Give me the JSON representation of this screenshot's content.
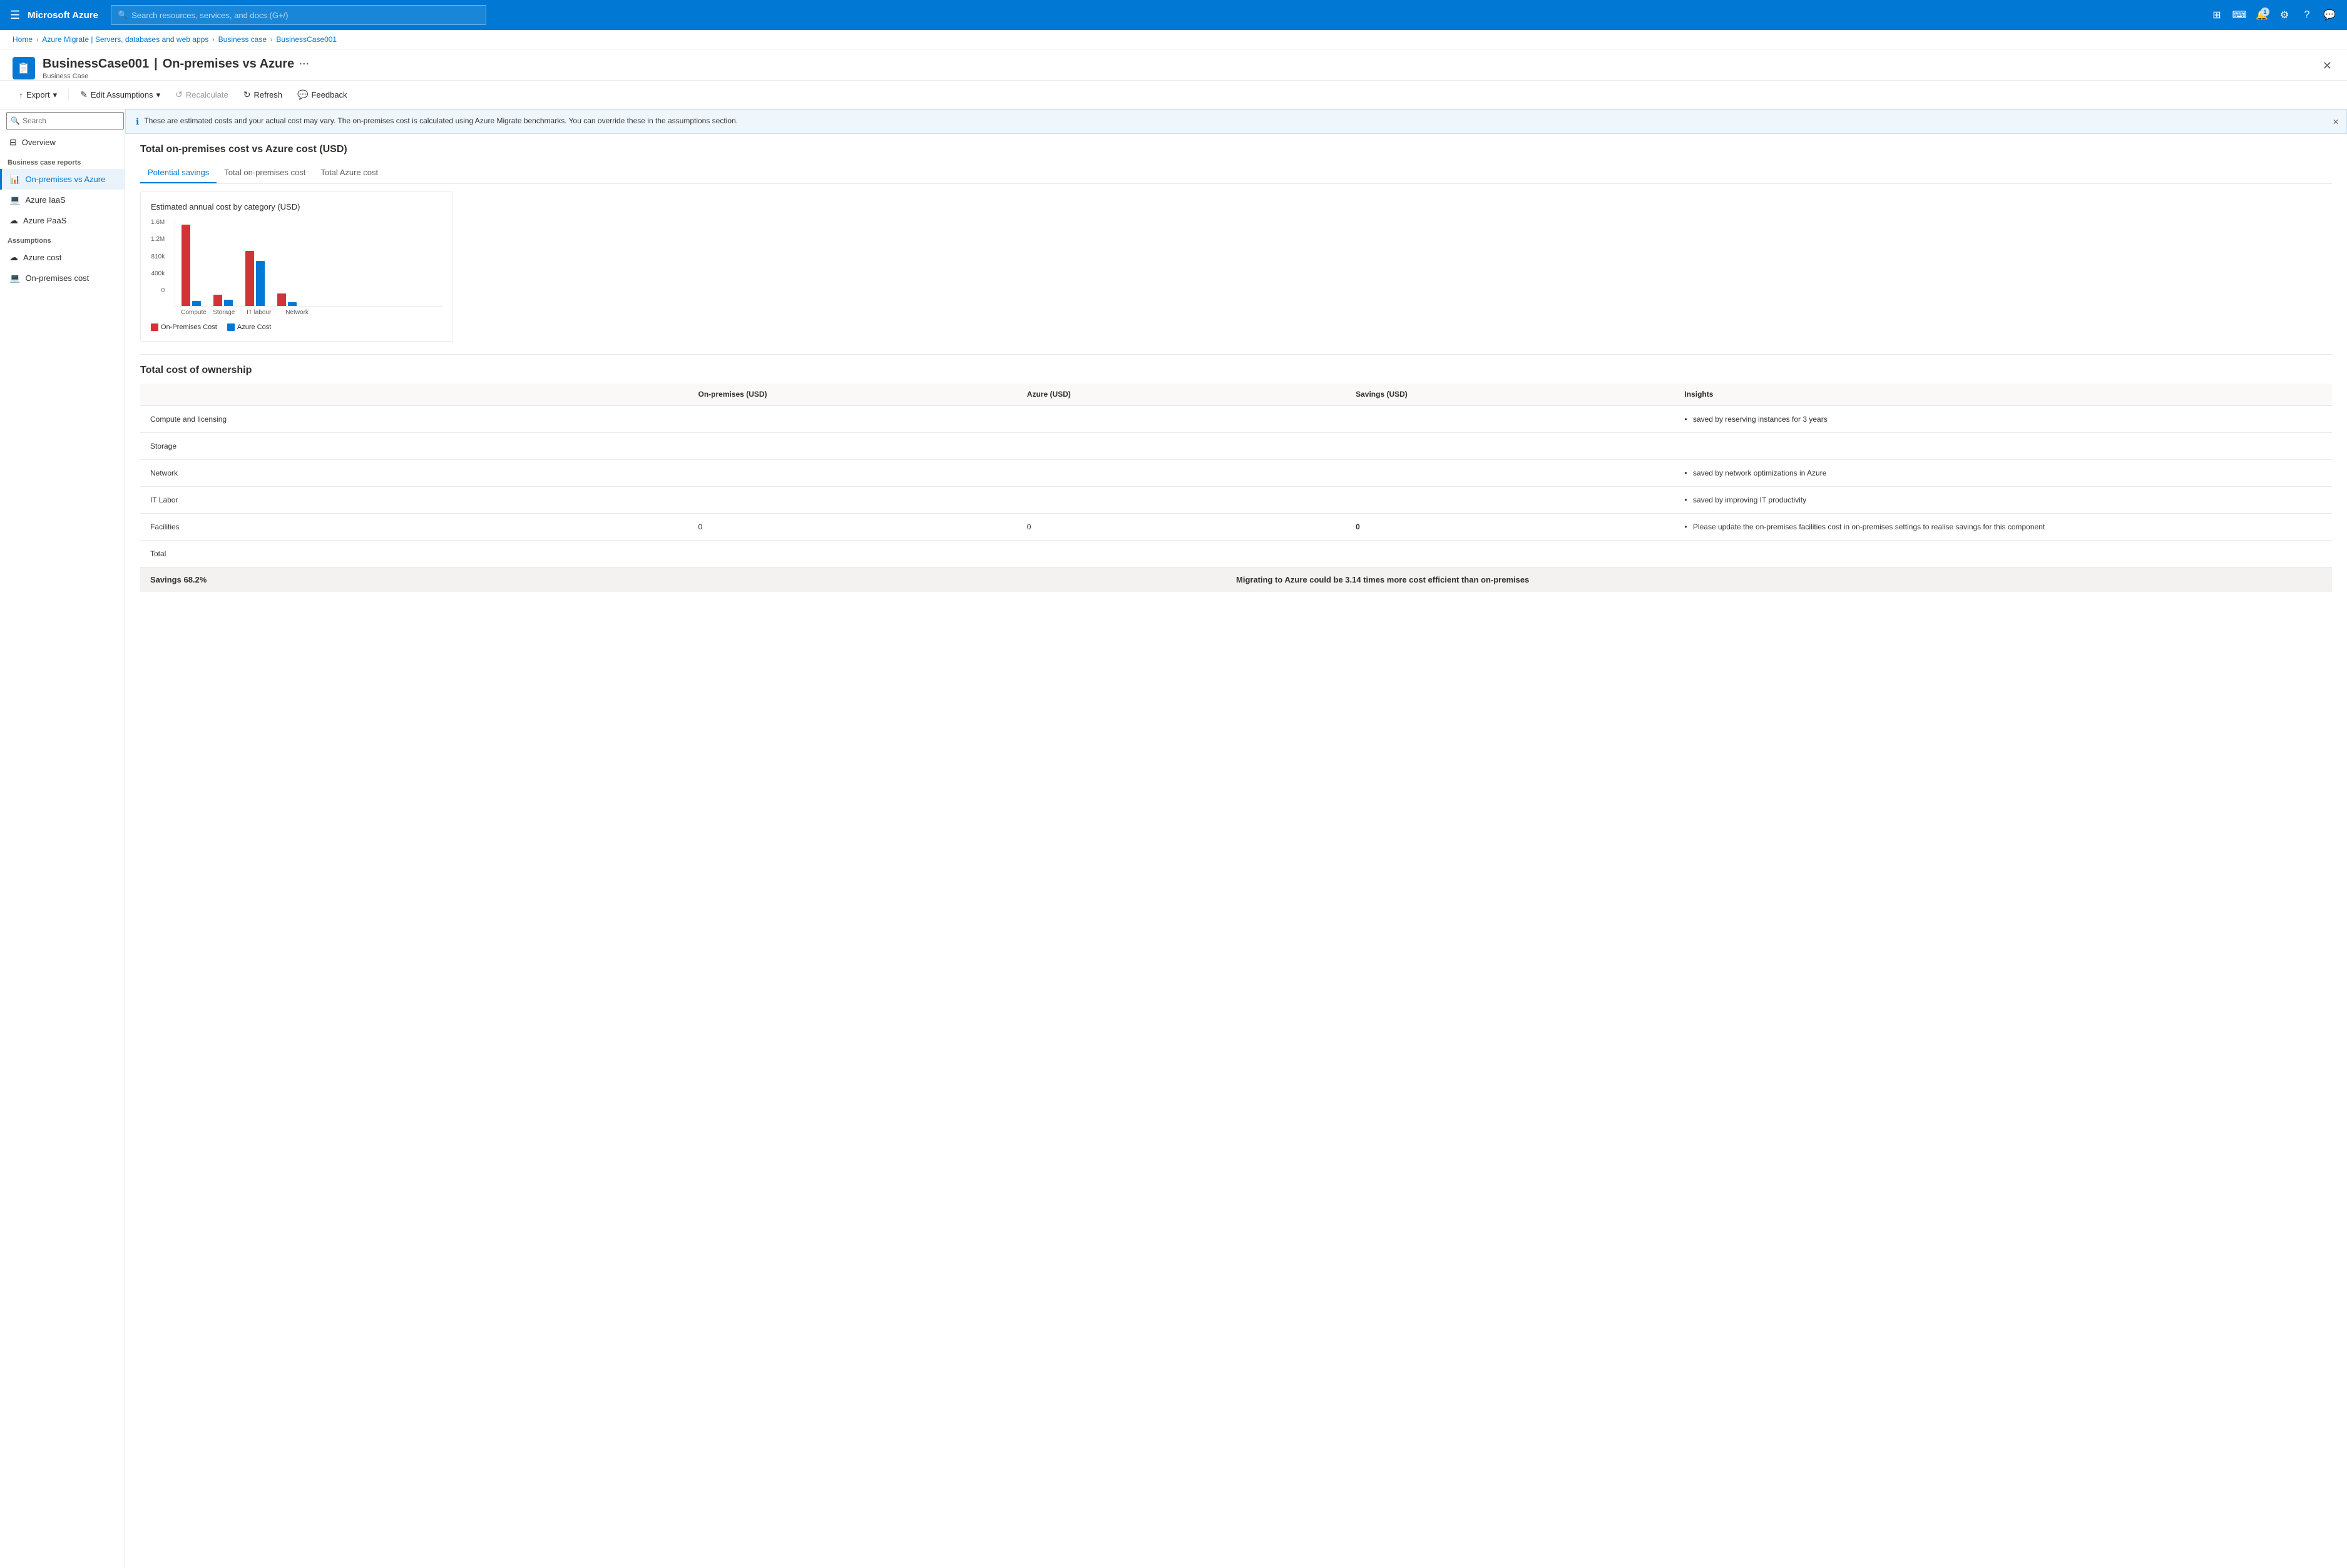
{
  "topNav": {
    "hamburger": "☰",
    "logo": "Microsoft Azure",
    "searchPlaceholder": "Search resources, services, and docs (G+/)",
    "icons": [
      {
        "name": "portal-icon",
        "symbol": "⊞",
        "badge": null
      },
      {
        "name": "cloud-shell-icon",
        "symbol": "⌨",
        "badge": null
      },
      {
        "name": "notifications-icon",
        "symbol": "🔔",
        "badge": "1"
      },
      {
        "name": "settings-icon",
        "symbol": "⚙",
        "badge": null
      },
      {
        "name": "help-icon",
        "symbol": "?",
        "badge": null
      },
      {
        "name": "feedback-icon",
        "symbol": "💬",
        "badge": null
      }
    ]
  },
  "breadcrumb": {
    "items": [
      "Home",
      "Azure Migrate | Servers, databases and web apps",
      "Business case",
      "BusinessCase001"
    ]
  },
  "pageHeader": {
    "icon": "📋",
    "titlePrefix": "BusinessCase001",
    "titleSep": "|",
    "titleSuffix": "On-premises vs Azure",
    "subtitle": "Business Case"
  },
  "toolbar": {
    "export": "Export",
    "editAssumptions": "Edit Assumptions",
    "recalculate": "Recalculate",
    "refresh": "Refresh",
    "feedback": "Feedback"
  },
  "infoBanner": "These are estimated costs and your actual cost may vary. The on-premises cost is calculated using Azure Migrate benchmarks. You can override these in the assumptions section.",
  "sidebar": {
    "searchPlaceholder": "Search",
    "overview": "Overview",
    "businessCaseReports": "Business case reports",
    "navItems": [
      {
        "label": "On-premises vs Azure",
        "active": true,
        "icon": "📊"
      },
      {
        "label": "Azure IaaS",
        "active": false,
        "icon": "💻"
      },
      {
        "label": "Azure PaaS",
        "active": false,
        "icon": "☁"
      }
    ],
    "assumptions": "Assumptions",
    "assumptionItems": [
      {
        "label": "Azure cost",
        "icon": "☁"
      },
      {
        "label": "On-premises cost",
        "icon": "💻"
      }
    ]
  },
  "mainContent": {
    "sectionTitle": "Total on-premises cost vs Azure cost (USD)",
    "tabs": [
      {
        "label": "Potential savings",
        "active": true
      },
      {
        "label": "Total on-premises cost",
        "active": false
      },
      {
        "label": "Total Azure cost",
        "active": false
      }
    ],
    "chart": {
      "title": "Estimated annual cost by category (USD)",
      "yAxisLabels": [
        "1.6M",
        "1.2M",
        "810k",
        "400k",
        "0"
      ],
      "groups": [
        {
          "label": "Compute",
          "onPremHeight": 130,
          "azureHeight": 8
        },
        {
          "label": "Storage",
          "onPremHeight": 18,
          "azureHeight": 10
        },
        {
          "label": "IT labour",
          "onPremHeight": 88,
          "azureHeight": 72
        },
        {
          "label": "Network",
          "onPremHeight": 20,
          "azureHeight": 6
        }
      ],
      "legend": {
        "onPremLabel": "On-Premises Cost",
        "azureLabel": "Azure Cost"
      }
    },
    "tco": {
      "title": "Total cost of ownership",
      "headers": [
        "",
        "On-premises (USD)",
        "Azure (USD)",
        "Savings (USD)",
        "Insights"
      ],
      "rows": [
        {
          "category": "Compute and licensing",
          "onPremises": "",
          "azure": "",
          "savings": "",
          "insight": "saved by reserving instances for 3 years"
        },
        {
          "category": "Storage",
          "onPremises": "",
          "azure": "",
          "savings": "",
          "insight": ""
        },
        {
          "category": "Network",
          "onPremises": "",
          "azure": "",
          "savings": "",
          "insight": "saved by network optimizations in Azure"
        },
        {
          "category": "IT Labor",
          "onPremises": "",
          "azure": "",
          "savings": "",
          "insight": "saved by improving IT productivity"
        },
        {
          "category": "Facilities",
          "onPremises": "0",
          "azure": "0",
          "savings": "0",
          "insight": "Please update the on-premises facilities cost in on-premises settings to realise savings for this component"
        },
        {
          "category": "Total",
          "onPremises": "",
          "azure": "",
          "savings": "",
          "insight": ""
        }
      ]
    },
    "footer": {
      "savingsLabel": "Savings 68.2%",
      "efficiencyLabel": "Migrating to Azure could be 3.14 times more cost efficient than on-premises"
    }
  }
}
